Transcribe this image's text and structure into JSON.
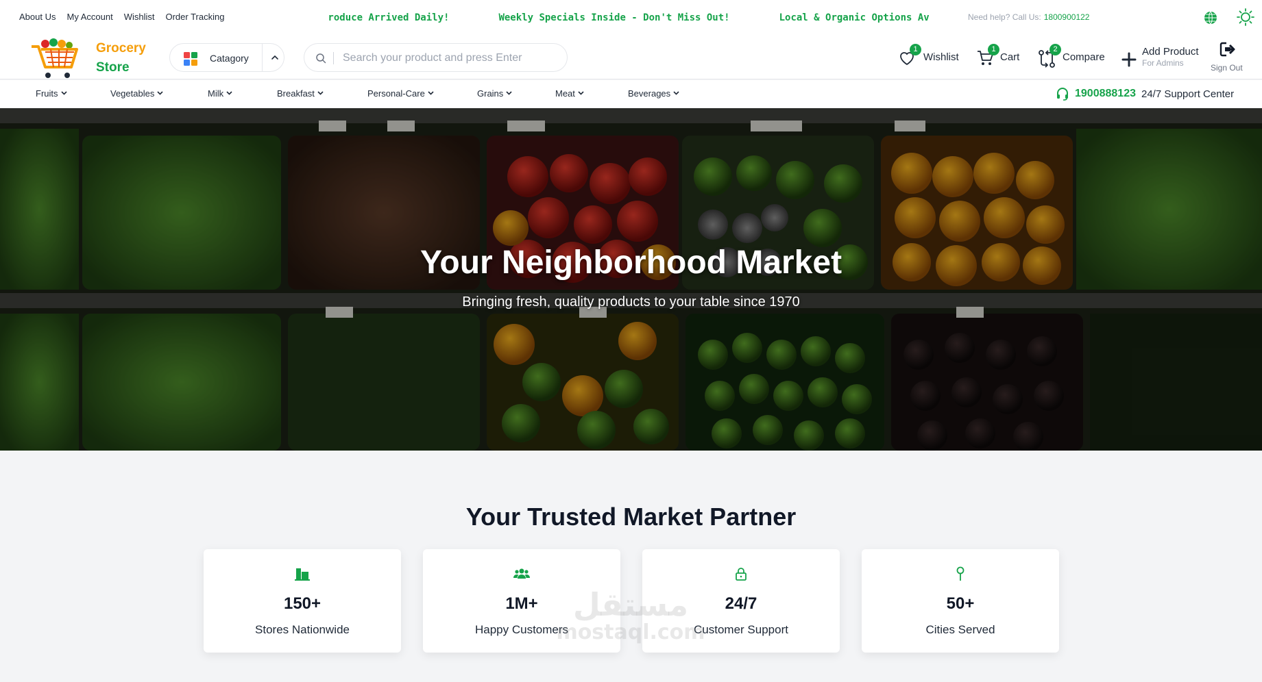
{
  "topbar": {
    "links": [
      "About Us",
      "My Account",
      "Wishlist",
      "Order Tracking"
    ],
    "ticker": [
      "'roduce Arrived Daily!",
      "Weekly Specials Inside - Don't Miss Out!",
      "Local & Organic Options Av"
    ],
    "help_label": "Need help? Call Us:",
    "help_phone": "1800900122",
    "icons": [
      "globe-icon",
      "sun-icon"
    ]
  },
  "header": {
    "logo_line1": "Grocery",
    "logo_line2": "Store",
    "category_label": "Catagory",
    "search_placeholder": "Search your product and press Enter",
    "wishlist": {
      "label": "Wishlist",
      "count": "1"
    },
    "cart": {
      "label": "Cart",
      "count": "1"
    },
    "compare": {
      "label": "Compare",
      "count": "2"
    },
    "add_product": {
      "title": "Add Product",
      "subtitle": "For Admins"
    },
    "sign_out": "Sign Out"
  },
  "nav": {
    "categories": [
      "Fruits",
      "Vegetables",
      "Milk",
      "Breakfast",
      "Personal-Care",
      "Grains",
      "Meat",
      "Beverages"
    ],
    "support_phone": "1900888123",
    "support_label": "24/7 Support Center"
  },
  "hero": {
    "title": "Your Neighborhood Market",
    "subtitle": "Bringing fresh, quality products to your table since 1970"
  },
  "stats": {
    "title": "Your Trusted Market Partner",
    "cards": [
      {
        "value": "150+",
        "label": "Stores Nationwide",
        "icon": "building-icon"
      },
      {
        "value": "1M+",
        "label": "Happy Customers",
        "icon": "users-icon"
      },
      {
        "value": "24/7",
        "label": "Customer Support",
        "icon": "lock-icon"
      },
      {
        "value": "50+",
        "label": "Cities Served",
        "icon": "pin-icon"
      }
    ]
  },
  "watermark": {
    "arabic": "مستقل",
    "latin": "mostaql.com"
  },
  "colors": {
    "brand_green": "#16a34a",
    "brand_orange": "#f59e0b",
    "page_bg": "#f3f4f6"
  }
}
